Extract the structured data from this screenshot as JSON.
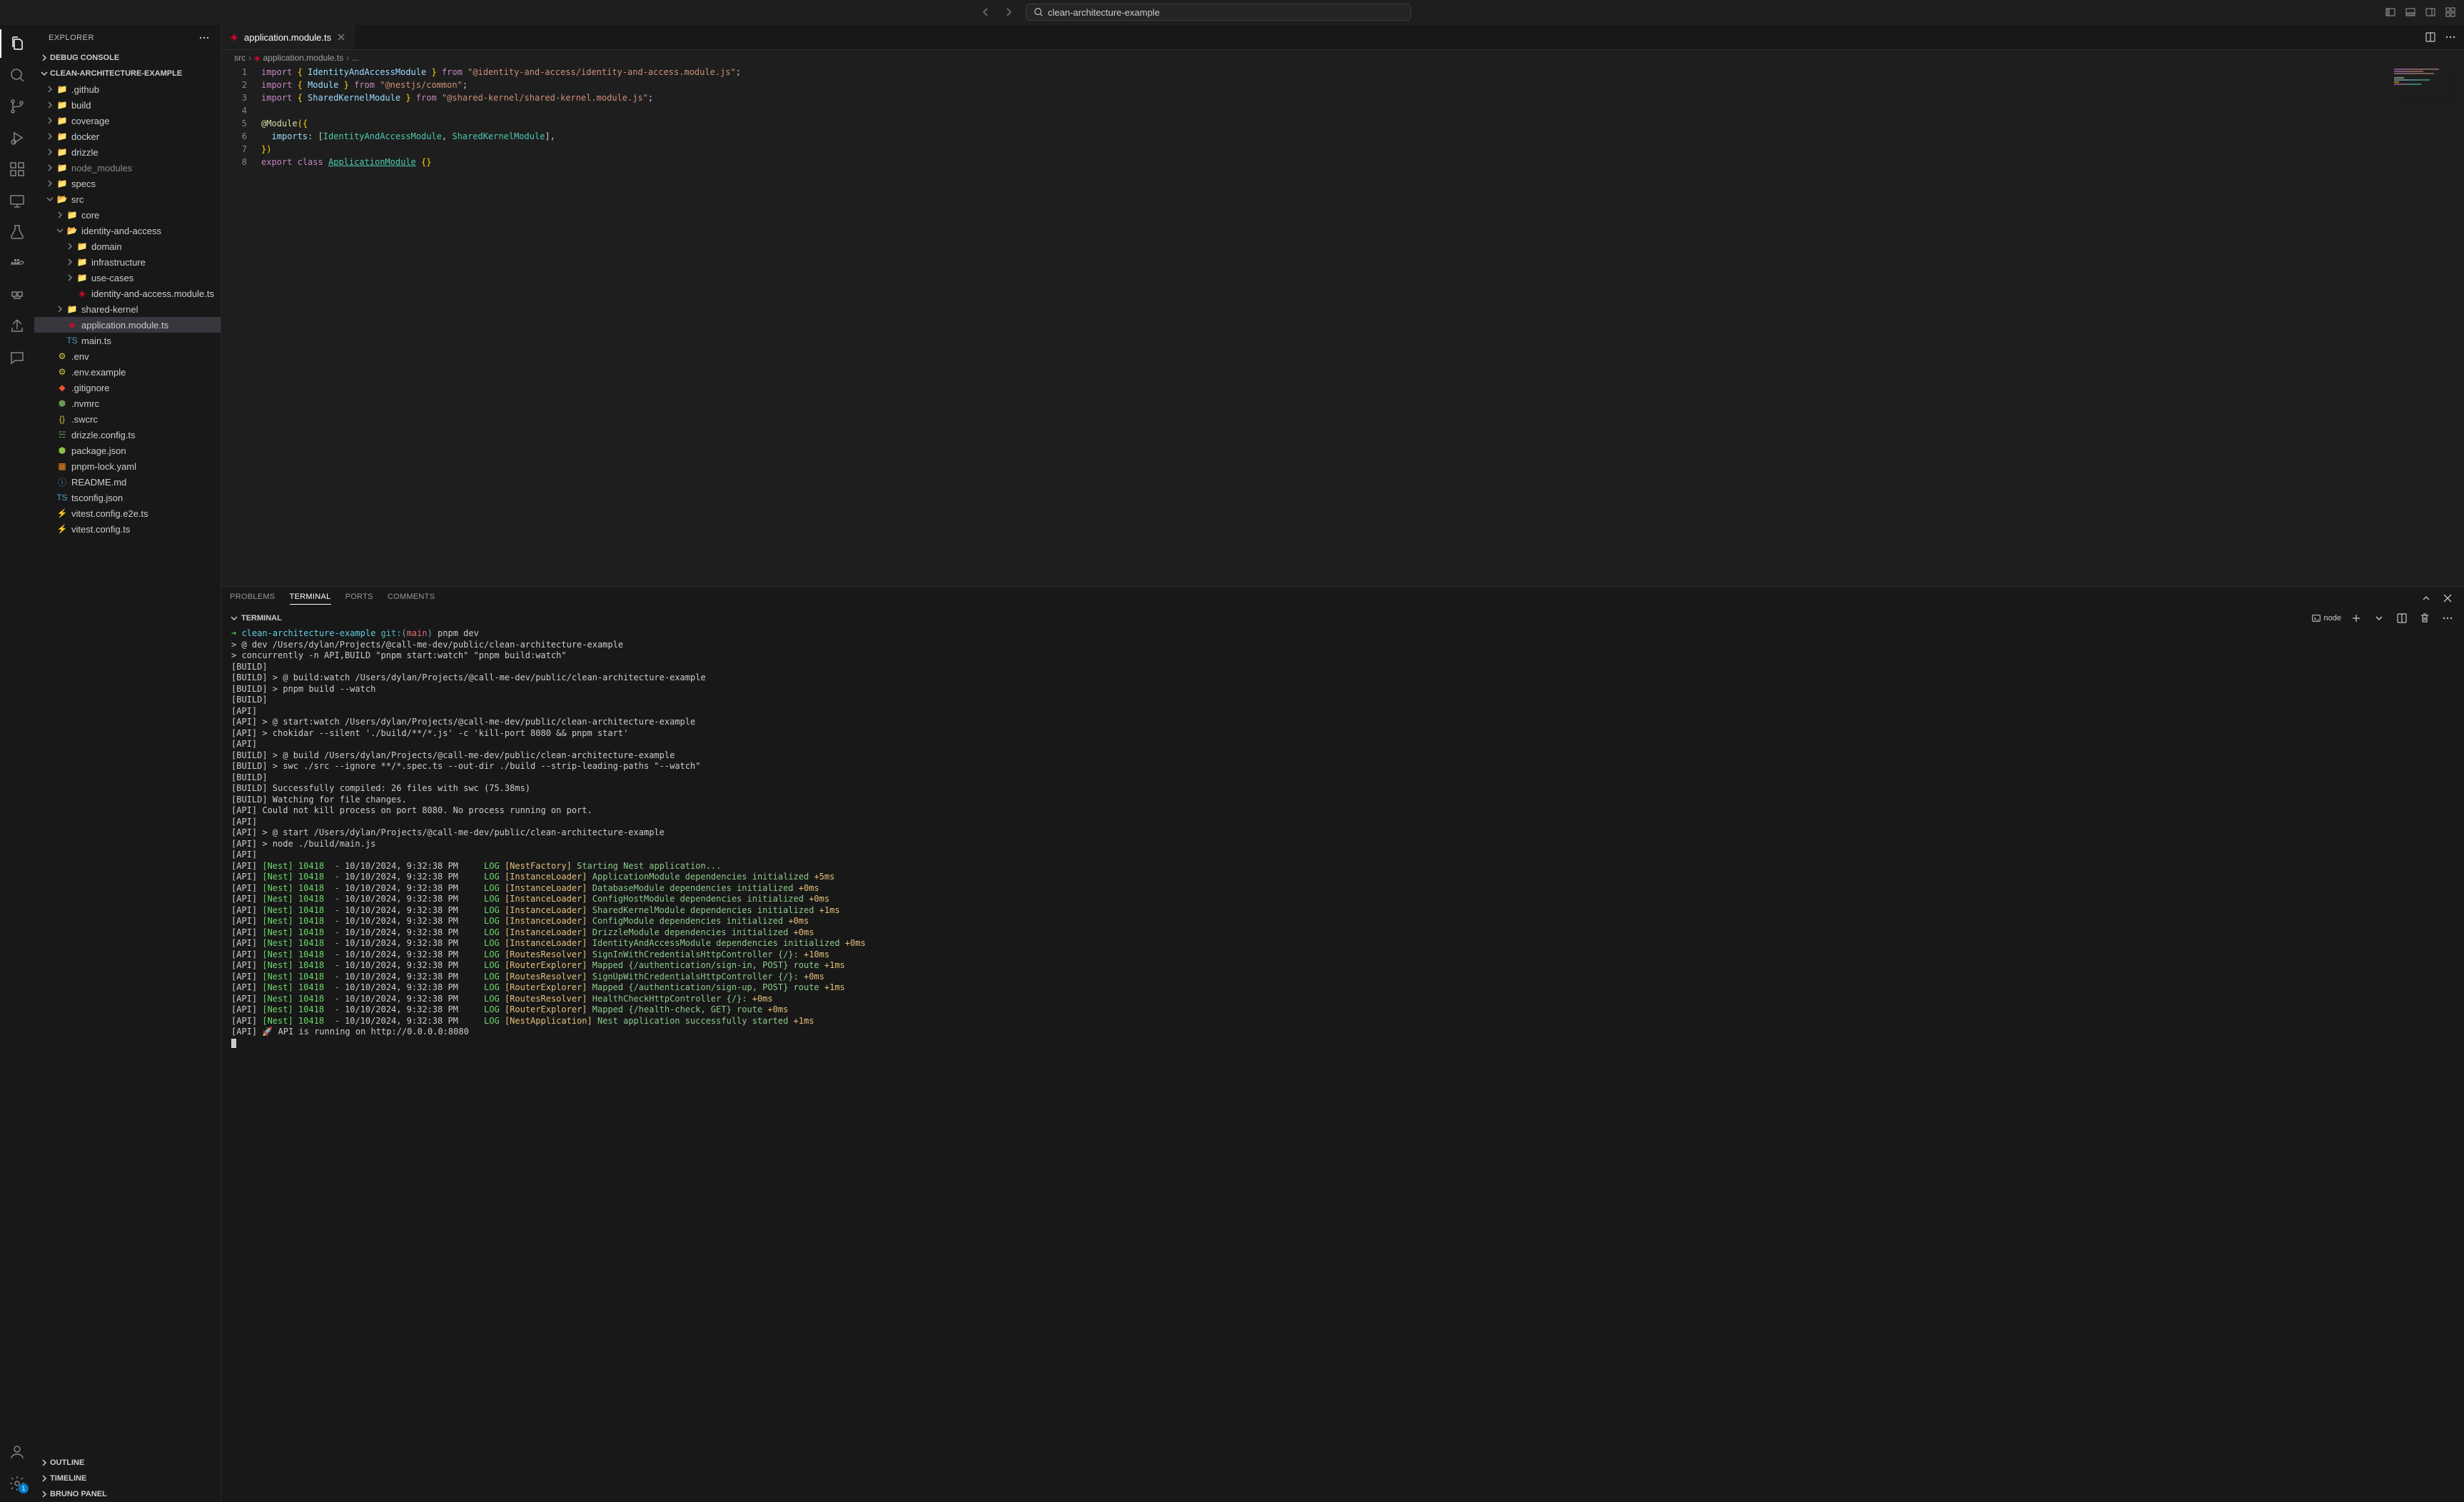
{
  "titlebar": {
    "search_text": "clean-architecture-example"
  },
  "sidebar": {
    "title": "EXPLORER",
    "sections": {
      "debug_console": "DEBUG CONSOLE",
      "project": "CLEAN-ARCHITECTURE-EXAMPLE",
      "outline": "OUTLINE",
      "timeline": "TIMELINE",
      "bruno": "BRUNO PANEL"
    },
    "tree": {
      "github": ".github",
      "build": "build",
      "coverage": "coverage",
      "docker": "docker",
      "drizzle": "drizzle",
      "node_modules": "node_modules",
      "specs": "specs",
      "src": "src",
      "core": "core",
      "identity_and_access": "identity-and-access",
      "domain": "domain",
      "infrastructure": "infrastructure",
      "use_cases": "use-cases",
      "iam_module": "identity-and-access.module.ts",
      "shared_kernel": "shared-kernel",
      "app_module": "application.module.ts",
      "main_ts": "main.ts",
      "env": ".env",
      "env_example": ".env.example",
      "gitignore": ".gitignore",
      "nvmrc": ".nvmrc",
      "swcrc": ".swcrc",
      "drizzle_config": "drizzle.config.ts",
      "package_json": "package.json",
      "pnpm_lock": "pnpm-lock.yaml",
      "readme": "README.md",
      "tsconfig": "tsconfig.json",
      "vitest_e2e": "vitest.config.e2e.ts",
      "vitest": "vitest.config.ts"
    }
  },
  "activity_badge": "1",
  "tab": {
    "label": "application.module.ts"
  },
  "breadcrumbs": {
    "a": "src",
    "b": "application.module.ts",
    "c": "..."
  },
  "code": {
    "l1": {
      "a": "import",
      "b": " { ",
      "c": "IdentityAndAccessModule",
      "d": " } ",
      "e": "from",
      "f": " ",
      "g": "\"@identity-and-access/identity-and-access.module.js\"",
      "h": ";"
    },
    "l2": {
      "a": "import",
      "b": " { ",
      "c": "Module",
      "d": " } ",
      "e": "from",
      "f": " ",
      "g": "\"@nestjs/common\"",
      "h": ";"
    },
    "l3": {
      "a": "import",
      "b": " { ",
      "c": "SharedKernelModule",
      "d": " } ",
      "e": "from",
      "f": " ",
      "g": "\"@shared-kernel/shared-kernel.module.js\"",
      "h": ";"
    },
    "l5": {
      "a": "@",
      "b": "Module",
      "c": "({"
    },
    "l6": {
      "a": "  imports",
      "b": ": [",
      "c": "IdentityAndAccessModule",
      "d": ", ",
      "e": "SharedKernelModule",
      "f": "],"
    },
    "l7": "})",
    "l8": {
      "a": "export",
      "b": " ",
      "c": "class",
      "d": " ",
      "e": "ApplicationModule",
      "f": " {}"
    }
  },
  "line_numbers": [
    "1",
    "2",
    "3",
    "4",
    "5",
    "6",
    "7",
    "8"
  ],
  "panel": {
    "tabs": {
      "problems": "PROBLEMS",
      "terminal": "TERMINAL",
      "ports": "PORTS",
      "comments": "COMMENTS"
    },
    "subheader": "TERMINAL",
    "profile": "node"
  },
  "prompt": {
    "arrow": "➜ ",
    "dir": "clean-architecture-example",
    "git": " git:(",
    "branch": "main",
    "git2": ")",
    "cmd": " pnpm dev"
  },
  "term": [
    {
      "t": "plain",
      "v": ""
    },
    {
      "t": "plain",
      "v": "> @ dev /Users/dylan/Projects/@call-me-dev/public/clean-architecture-example"
    },
    {
      "t": "plain",
      "v": "> concurrently -n API,BUILD \"pnpm start:watch\" \"pnpm build:watch\""
    },
    {
      "t": "plain",
      "v": ""
    },
    {
      "t": "plain",
      "v": "[BUILD] "
    },
    {
      "t": "plain",
      "v": "[BUILD] > @ build:watch /Users/dylan/Projects/@call-me-dev/public/clean-architecture-example"
    },
    {
      "t": "plain",
      "v": "[BUILD] > pnpm build --watch"
    },
    {
      "t": "plain",
      "v": "[BUILD] "
    },
    {
      "t": "plain",
      "v": "[API] "
    },
    {
      "t": "plain",
      "v": "[API] > @ start:watch /Users/dylan/Projects/@call-me-dev/public/clean-architecture-example"
    },
    {
      "t": "plain",
      "v": "[API] > chokidar --silent './build/**/*.js' -c 'kill-port 8080 && pnpm start'"
    },
    {
      "t": "plain",
      "v": "[API] "
    },
    {
      "t": "plain",
      "v": "[BUILD] > @ build /Users/dylan/Projects/@call-me-dev/public/clean-architecture-example"
    },
    {
      "t": "plain",
      "v": "[BUILD] > swc ./src --ignore **/*.spec.ts --out-dir ./build --strip-leading-paths \"--watch\""
    },
    {
      "t": "plain",
      "v": "[BUILD] "
    },
    {
      "t": "plain",
      "v": "[BUILD] Successfully compiled: 26 files with swc (75.38ms)"
    },
    {
      "t": "plain",
      "v": "[BUILD] Watching for file changes."
    },
    {
      "t": "plain",
      "v": "[API] Could not kill process on port 8080. No process running on port."
    },
    {
      "t": "plain",
      "v": "[API] "
    },
    {
      "t": "plain",
      "v": "[API] > @ start /Users/dylan/Projects/@call-me-dev/public/clean-architecture-example"
    },
    {
      "t": "plain",
      "v": "[API] > node ./build/main.js"
    },
    {
      "t": "plain",
      "v": "[API] "
    },
    {
      "t": "nest",
      "pre": "[API] ",
      "nest": "[Nest] 10418  - ",
      "ts": "10/10/2024, 9:32:38 PM",
      "log": "     LOG ",
      "ctx": "[NestFactory] ",
      "msg": "Starting Nest application...",
      "extra": ""
    },
    {
      "t": "nest",
      "pre": "[API] ",
      "nest": "[Nest] 10418  - ",
      "ts": "10/10/2024, 9:32:38 PM",
      "log": "     LOG ",
      "ctx": "[InstanceLoader] ",
      "msg": "ApplicationModule dependencies initialized ",
      "extra": "+5ms"
    },
    {
      "t": "nest",
      "pre": "[API] ",
      "nest": "[Nest] 10418  - ",
      "ts": "10/10/2024, 9:32:38 PM",
      "log": "     LOG ",
      "ctx": "[InstanceLoader] ",
      "msg": "DatabaseModule dependencies initialized ",
      "extra": "+0ms"
    },
    {
      "t": "nest",
      "pre": "[API] ",
      "nest": "[Nest] 10418  - ",
      "ts": "10/10/2024, 9:32:38 PM",
      "log": "     LOG ",
      "ctx": "[InstanceLoader] ",
      "msg": "ConfigHostModule dependencies initialized ",
      "extra": "+0ms"
    },
    {
      "t": "nest",
      "pre": "[API] ",
      "nest": "[Nest] 10418  - ",
      "ts": "10/10/2024, 9:32:38 PM",
      "log": "     LOG ",
      "ctx": "[InstanceLoader] ",
      "msg": "SharedKernelModule dependencies initialized ",
      "extra": "+1ms"
    },
    {
      "t": "nest",
      "pre": "[API] ",
      "nest": "[Nest] 10418  - ",
      "ts": "10/10/2024, 9:32:38 PM",
      "log": "     LOG ",
      "ctx": "[InstanceLoader] ",
      "msg": "ConfigModule dependencies initialized ",
      "extra": "+0ms"
    },
    {
      "t": "nest",
      "pre": "[API] ",
      "nest": "[Nest] 10418  - ",
      "ts": "10/10/2024, 9:32:38 PM",
      "log": "     LOG ",
      "ctx": "[InstanceLoader] ",
      "msg": "DrizzleModule dependencies initialized ",
      "extra": "+0ms"
    },
    {
      "t": "nest",
      "pre": "[API] ",
      "nest": "[Nest] 10418  - ",
      "ts": "10/10/2024, 9:32:38 PM",
      "log": "     LOG ",
      "ctx": "[InstanceLoader] ",
      "msg": "IdentityAndAccessModule dependencies initialized ",
      "extra": "+0ms"
    },
    {
      "t": "nest",
      "pre": "[API] ",
      "nest": "[Nest] 10418  - ",
      "ts": "10/10/2024, 9:32:38 PM",
      "log": "     LOG ",
      "ctx": "[RoutesResolver] ",
      "msg": "SignInWithCredentialsHttpController {/}: ",
      "extra": "+10ms"
    },
    {
      "t": "nest",
      "pre": "[API] ",
      "nest": "[Nest] 10418  - ",
      "ts": "10/10/2024, 9:32:38 PM",
      "log": "     LOG ",
      "ctx": "[RouterExplorer] ",
      "msg": "Mapped {/authentication/sign-in, POST} route ",
      "extra": "+1ms"
    },
    {
      "t": "nest",
      "pre": "[API] ",
      "nest": "[Nest] 10418  - ",
      "ts": "10/10/2024, 9:32:38 PM",
      "log": "     LOG ",
      "ctx": "[RoutesResolver] ",
      "msg": "SignUpWithCredentialsHttpController {/}: ",
      "extra": "+0ms"
    },
    {
      "t": "nest",
      "pre": "[API] ",
      "nest": "[Nest] 10418  - ",
      "ts": "10/10/2024, 9:32:38 PM",
      "log": "     LOG ",
      "ctx": "[RouterExplorer] ",
      "msg": "Mapped {/authentication/sign-up, POST} route ",
      "extra": "+1ms"
    },
    {
      "t": "nest",
      "pre": "[API] ",
      "nest": "[Nest] 10418  - ",
      "ts": "10/10/2024, 9:32:38 PM",
      "log": "     LOG ",
      "ctx": "[RoutesResolver] ",
      "msg": "HealthCheckHttpController {/}: ",
      "extra": "+0ms"
    },
    {
      "t": "nest",
      "pre": "[API] ",
      "nest": "[Nest] 10418  - ",
      "ts": "10/10/2024, 9:32:38 PM",
      "log": "     LOG ",
      "ctx": "[RouterExplorer] ",
      "msg": "Mapped {/health-check, GET} route ",
      "extra": "+0ms"
    },
    {
      "t": "nest",
      "pre": "[API] ",
      "nest": "[Nest] 10418  - ",
      "ts": "10/10/2024, 9:32:38 PM",
      "log": "     LOG ",
      "ctx": "[NestApplication] ",
      "msg": "Nest application successfully started ",
      "extra": "+1ms"
    },
    {
      "t": "plain",
      "v": "[API] 🚀 API is running on http://0.0.0.0:8080"
    }
  ]
}
